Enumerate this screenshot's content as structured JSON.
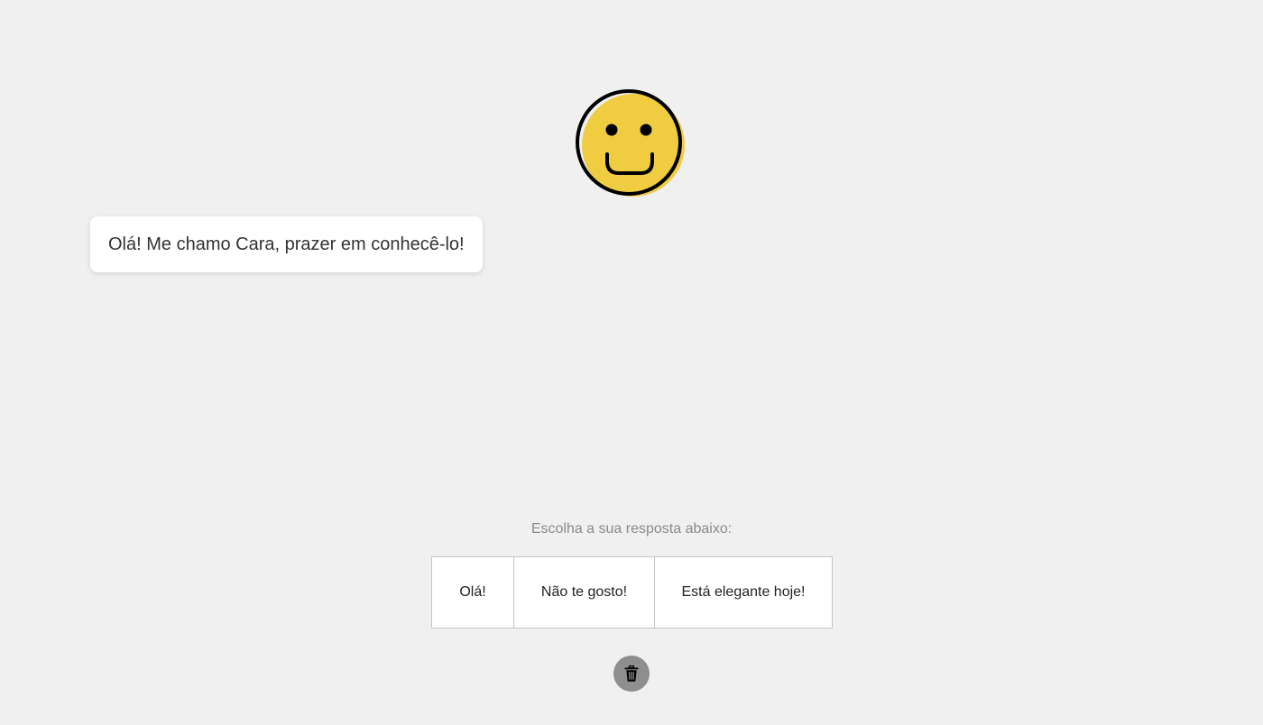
{
  "speech": {
    "text": "Olá! Me chamo Cara, prazer em conhecê-lo!"
  },
  "prompt": {
    "text": "Escolha a sua resposta abaixo:"
  },
  "answers": [
    {
      "label": "Olá!"
    },
    {
      "label": "Não te gosto!"
    },
    {
      "label": "Está elegante hoje!"
    }
  ],
  "icons": {
    "face": "smiley-face-icon",
    "trash": "trash-icon"
  },
  "colors": {
    "background": "#f0f0f0",
    "face_fill": "#f0cd40",
    "face_outline": "#000000",
    "trash_button": "#8e8e8e"
  }
}
